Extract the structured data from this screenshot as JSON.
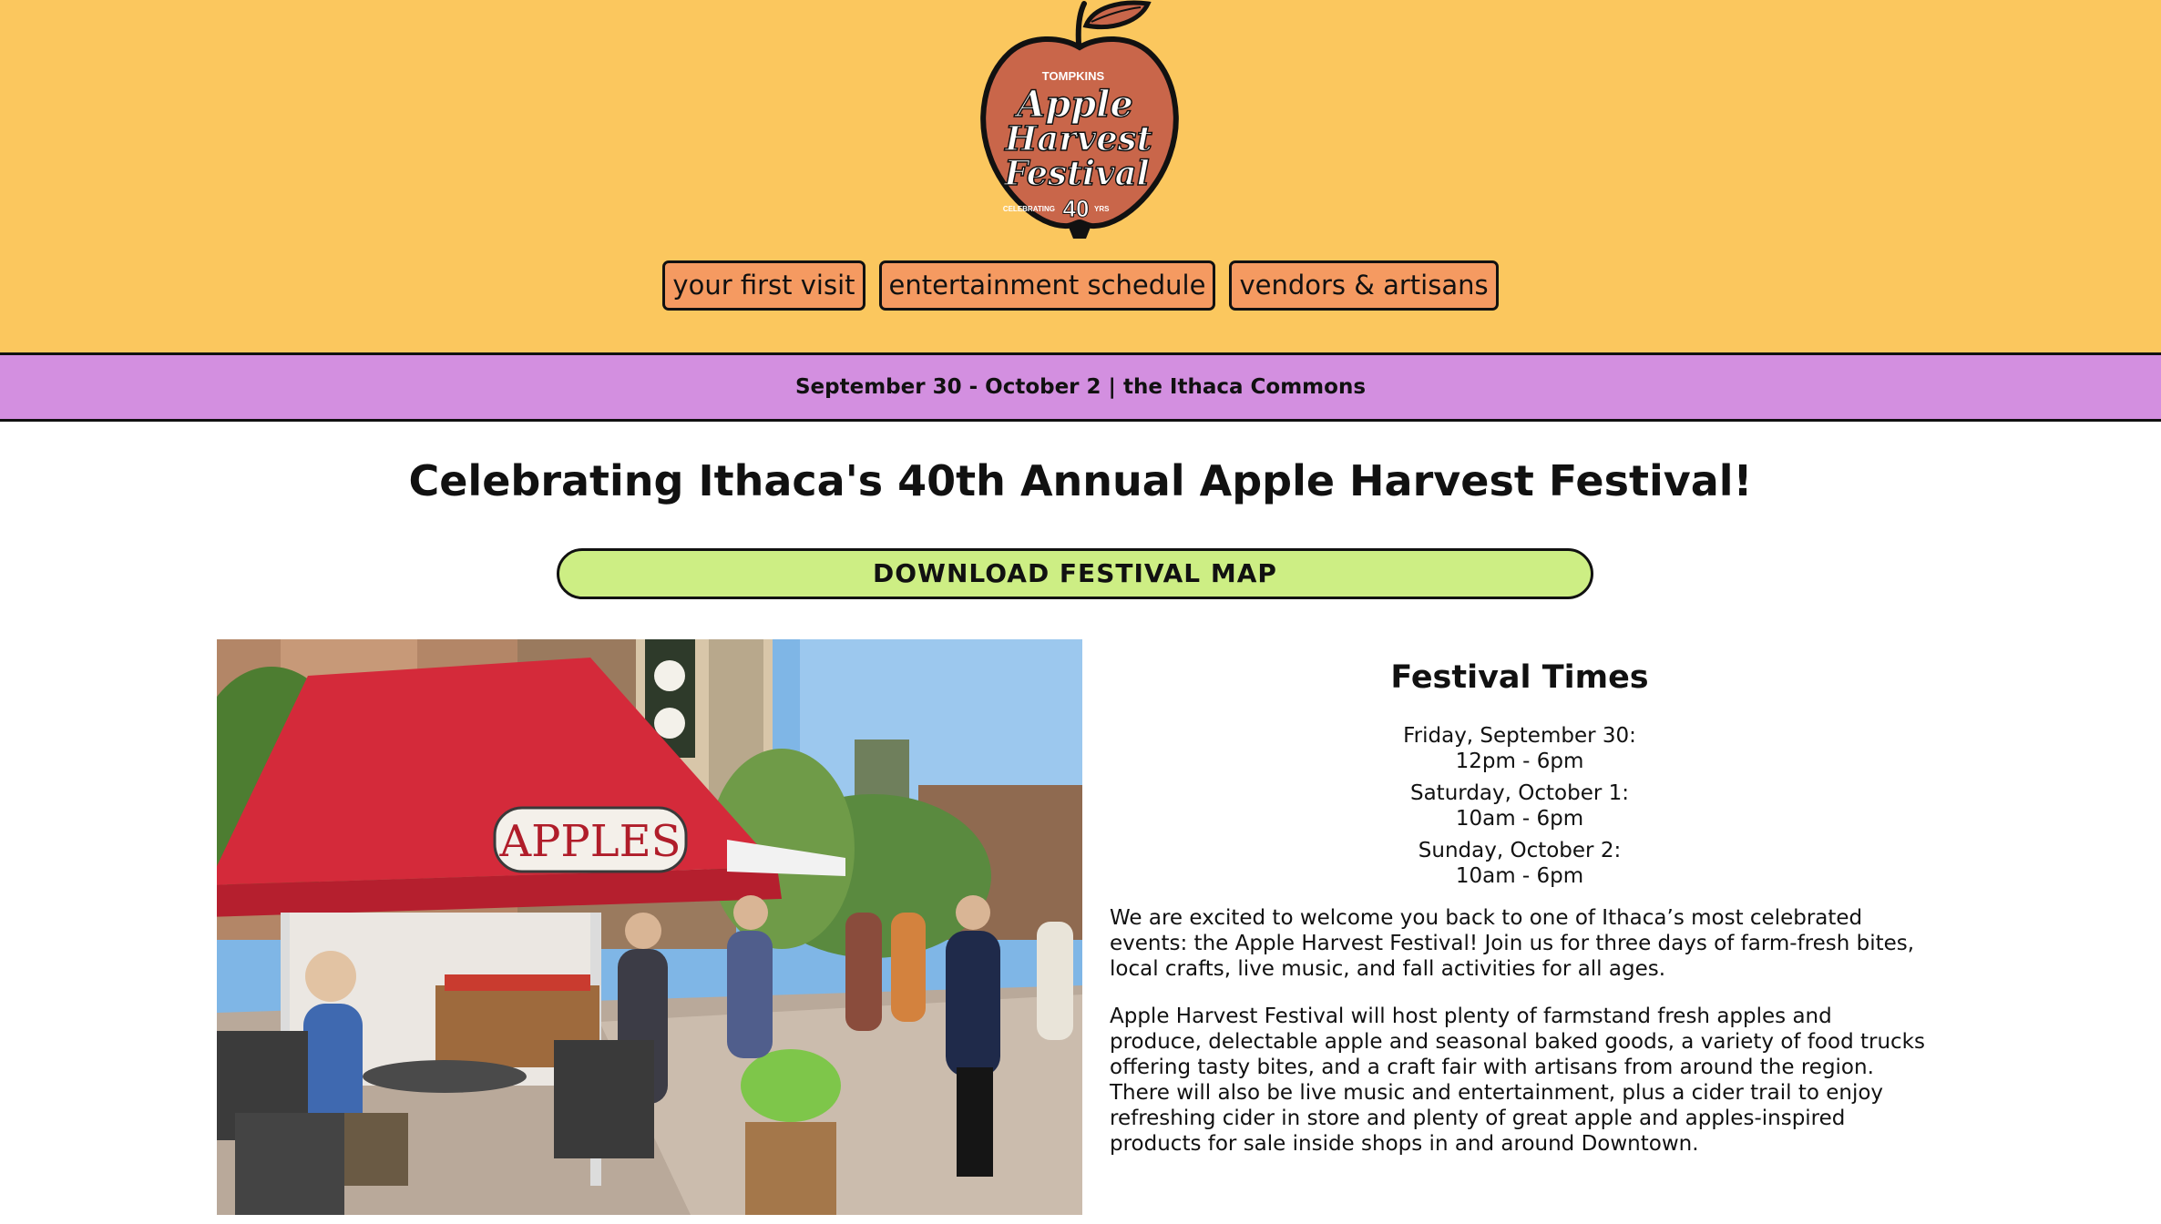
{
  "header": {
    "logo": {
      "brand": "TOMPKINS",
      "line1": "Apple",
      "line2": "Harvest",
      "line3": "Festival",
      "badge_prefix": "CELEBRATING",
      "badge_number": "40",
      "badge_suffix": "YRS"
    },
    "nav": [
      {
        "label": "your first visit"
      },
      {
        "label": "entertainment schedule"
      },
      {
        "label": "vendors & artisans"
      }
    ]
  },
  "strip": {
    "text": "September 30 - October 2 | the Ithaca Commons"
  },
  "main": {
    "title": "Celebrating Ithaca's 40th Annual Apple Harvest Festival!",
    "map_button": "DOWNLOAD FESTIVAL MAP",
    "photo": {
      "sign_text": "APPLES"
    },
    "times": {
      "heading": "Festival Times",
      "days": [
        {
          "day": "Friday, September 30:",
          "hours": "12pm - 6pm"
        },
        {
          "day": "Saturday, October 1:",
          "hours": "10am - 6pm"
        },
        {
          "day": "Sunday, October 2:",
          "hours": "10am - 6pm"
        }
      ]
    },
    "paragraphs": [
      "We are excited to welcome you back to one of Ithaca’s most celebrated events: the Apple Harvest Festival! Join us for three days of farm-fresh bites, local crafts, live music, and fall activities for all ages.",
      "Apple Harvest Festival will host plenty of farmstand fresh apples and produce, delectable apple and seasonal baked goods, a variety of food trucks offering tasty bites, and a craft fair with artisans from around the region. There will also be live music and entertainment, plus a cider trail to enjoy refreshing cider in store and plenty of great apple and apples-inspired products for sale inside shops in and around Downtown."
    ]
  },
  "colors": {
    "header_bg": "#fbc75e",
    "nav_button_bg": "#f59a61",
    "strip_bg": "#d38fe0",
    "map_button_bg": "#cdee84",
    "logo_apple": "#c9664a"
  }
}
